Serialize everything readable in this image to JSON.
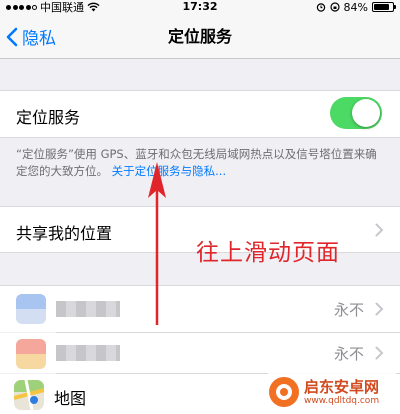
{
  "status_bar": {
    "carrier": "中国联通",
    "time": "17:32",
    "battery": "84%",
    "battery_level": 0.84
  },
  "nav": {
    "back_label": "隐私",
    "title": "定位服务"
  },
  "location_services": {
    "label": "定位服务",
    "enabled": true,
    "description": "“定位服务”使用 GPS、蓝牙和众包无线局域网热点以及信号塔位置来确定您的大致方位。",
    "link": "关于定位服务与隐私..."
  },
  "share_location": {
    "label": "共享我的位置"
  },
  "apps": [
    {
      "name": "",
      "value": "永不"
    },
    {
      "name": "",
      "value": "永不"
    },
    {
      "name": "地图",
      "value": ""
    }
  ],
  "annotation": "往上滑动页面",
  "watermark": {
    "name": "启东安卓网",
    "url": "www.qdltdq.com"
  },
  "colors": {
    "accent": "#007aff",
    "toggle_on": "#4cd964",
    "annotation": "#e0262b",
    "background": "#efeff4"
  }
}
